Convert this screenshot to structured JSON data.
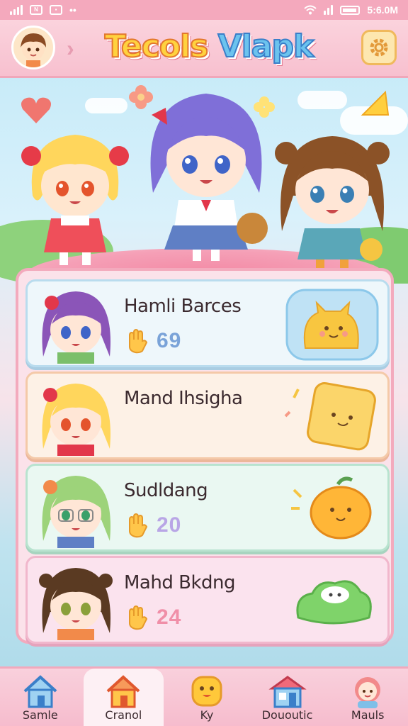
{
  "status": {
    "time": "5:6.0M"
  },
  "header": {
    "title_part1": "Tecols",
    "title_part2": "Vlapk"
  },
  "characters": [
    {
      "name": "Hamli Barces",
      "stat": "69",
      "stat_color": "#7aa3d8",
      "theme": "blue"
    },
    {
      "name": "Mand Ihsigha",
      "stat": "",
      "stat_color": "#e88fa6",
      "theme": "orange"
    },
    {
      "name": "Sudldang",
      "stat": "20",
      "stat_color": "#b9a6e6",
      "theme": "green"
    },
    {
      "name": "Mahd Bkdng",
      "stat": "24",
      "stat_color": "#f08fa8",
      "theme": "pink"
    }
  ],
  "nav": [
    {
      "label": "Samle",
      "icon": "home-icon"
    },
    {
      "label": "Cranol",
      "icon": "house-icon",
      "active": true
    },
    {
      "label": "Ky",
      "icon": "chick-icon"
    },
    {
      "label": "Dououtic",
      "icon": "shop-icon"
    },
    {
      "label": "Mauls",
      "icon": "profile-icon"
    }
  ],
  "colors": {
    "accent_pink": "#f4a9bd",
    "title_yellow": "#ffd23f",
    "title_blue": "#6cc3ee"
  }
}
